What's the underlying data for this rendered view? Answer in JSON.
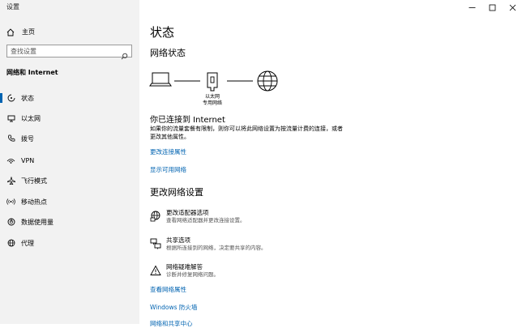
{
  "window": {
    "title": "设置",
    "controls": {
      "minimize": "—",
      "maximize": "☐",
      "close": "✕"
    }
  },
  "sidebar": {
    "home_label": "主页",
    "search_placeholder": "查找设置",
    "section_title": "网络和 Internet",
    "items": [
      {
        "label": "状态",
        "icon": "home-status-icon",
        "active": true
      },
      {
        "label": "以太网",
        "icon": "ethernet-icon"
      },
      {
        "label": "拨号",
        "icon": "dialup-icon"
      },
      {
        "label": "VPN",
        "icon": "vpn-icon"
      },
      {
        "label": "飞行模式",
        "icon": "airplane-icon"
      },
      {
        "label": "移动热点",
        "icon": "hotspot-icon"
      },
      {
        "label": "数据使用量",
        "icon": "data-usage-icon"
      },
      {
        "label": "代理",
        "icon": "globe-icon"
      }
    ]
  },
  "main": {
    "title": "状态",
    "network_status_heading": "网络状态",
    "diagram": {
      "adapter_label": "以太网",
      "adapter_sub": "专用网络"
    },
    "connected_title": "你已连接到 Internet",
    "connected_desc": "如果你的流量套餐有限制，则你可以将此网络设置为按流量计费的连接，或者更改其他属性。",
    "links_top": [
      "更改连接属性",
      "显示可用网络"
    ],
    "change_heading": "更改网络设置",
    "options": [
      {
        "title": "更改适配器选项",
        "sub": "查看网络适配器并更改连接设置。",
        "icon": "adapter-globe-icon"
      },
      {
        "title": "共享选项",
        "sub": "根据所连接到的网络，决定要共享的内容。",
        "icon": "sharing-icon"
      },
      {
        "title": "网络疑难解答",
        "sub": "诊断并修复网络问题。",
        "icon": "warning-icon"
      }
    ],
    "links_bottom": [
      "查看网络属性",
      "Windows 防火墙",
      "网络和共享中心"
    ]
  }
}
